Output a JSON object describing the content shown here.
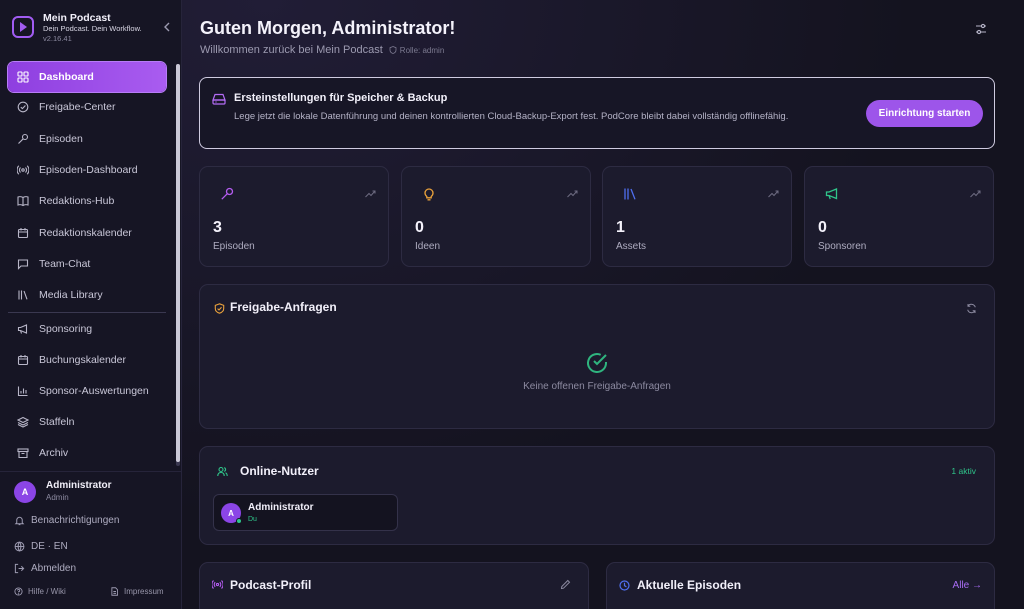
{
  "brand": {
    "title": "Mein Podcast",
    "subtitle": "Dein Podcast. Dein Workflow.",
    "version": "v2.16.41"
  },
  "nav": {
    "items": [
      {
        "label": "Dashboard",
        "icon": "grid-icon"
      },
      {
        "label": "Freigabe-Center",
        "icon": "check-circle-icon"
      },
      {
        "label": "Episoden",
        "icon": "microphone-icon"
      },
      {
        "label": "Episoden-Dashboard",
        "icon": "broadcast-icon"
      },
      {
        "label": "Redaktions-Hub",
        "icon": "book-icon"
      },
      {
        "label": "Redaktionskalender",
        "icon": "calendar-icon"
      },
      {
        "label": "Team-Chat",
        "icon": "chat-icon"
      },
      {
        "label": "Media Library",
        "icon": "library-icon"
      },
      {
        "label": "Sponsoring",
        "icon": "megaphone-icon"
      },
      {
        "label": "Buchungskalender",
        "icon": "calendar-icon"
      },
      {
        "label": "Sponsor-Auswertungen",
        "icon": "bar-chart-icon"
      },
      {
        "label": "Staffeln",
        "icon": "layers-icon"
      },
      {
        "label": "Archiv",
        "icon": "archive-icon"
      }
    ]
  },
  "user": {
    "initial": "A",
    "name": "Administrator",
    "role": "Admin"
  },
  "sidebar_footer": {
    "notifications": "Benachrichtigungen",
    "language": "DE · EN",
    "logout": "Abmelden",
    "help": "Hilfe / Wiki",
    "imprint": "Impressum"
  },
  "header": {
    "title": "Guten Morgen, Administrator!",
    "subtitle": "Willkommen zurück bei Mein Podcast",
    "role": "Rolle: admin"
  },
  "setup": {
    "title": "Ersteinstellungen für Speicher & Backup",
    "text": "Lege jetzt die lokale Datenführung und deinen kontrollierten Cloud-Backup-Export fest. PodCore bleibt dabei vollständig offlinefähig.",
    "button": "Einrichtung starten"
  },
  "stats": [
    {
      "value": "3",
      "label": "Episoden",
      "icon": "microphone-icon",
      "color": "#b45cf0"
    },
    {
      "value": "0",
      "label": "Ideen",
      "icon": "lightbulb-icon",
      "color": "#e9a13b"
    },
    {
      "value": "1",
      "label": "Assets",
      "icon": "library-icon",
      "color": "#4f6ff0"
    },
    {
      "value": "0",
      "label": "Sponsoren",
      "icon": "megaphone-icon",
      "color": "#2fc58a"
    }
  ],
  "approvals": {
    "title": "Freigabe-Anfragen",
    "empty": "Keine offenen Freigabe-Anfragen"
  },
  "online": {
    "title": "Online-Nutzer",
    "count": "1 aktiv",
    "user_initial": "A",
    "user_name": "Administrator",
    "user_tag": "Du"
  },
  "profile": {
    "title": "Podcast-Profil"
  },
  "episodes": {
    "title": "Aktuelle Episoden",
    "link": "Alle →"
  },
  "colors": {
    "accent": "#9d55ea",
    "success": "#2fc58a",
    "warning": "#e9a13b",
    "info": "#4f6ff0"
  }
}
